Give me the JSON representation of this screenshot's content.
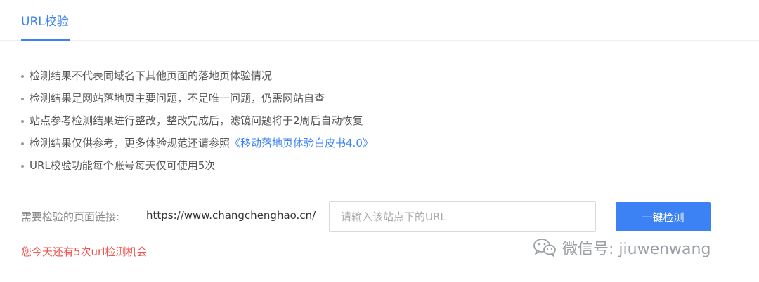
{
  "tabs": [
    {
      "label": "URL校验",
      "active": true
    }
  ],
  "notes": [
    {
      "text": "检测结果不代表同域名下其他页面的落地页体验情况"
    },
    {
      "text": "检测结果是网站落地页主要问题，不是唯一问题，仍需网站自查"
    },
    {
      "text": "站点参考检测结果进行整改，整改完成后，滤镜问题将于2周后自动恢复"
    },
    {
      "text": "检测结果仅供参考，更多体验规范还请参照",
      "link": "《移动落地页体验白皮书4.0》"
    },
    {
      "text": "URL校验功能每个账号每天仅可使用5次"
    }
  ],
  "form": {
    "label": "需要检验的页面链接:",
    "domain_prefix": "https://www.changchenghao.cn/",
    "input_placeholder": "请输入该站点下的URL",
    "input_value": "",
    "button_label": "一键检测"
  },
  "remaining_text": "您今天还有5次url检测机会",
  "watermark": {
    "icon": "wechat-icon",
    "text": "微信号: jiuwenwang"
  },
  "colors": {
    "accent": "#3d82f4",
    "warning": "#f0554f"
  }
}
